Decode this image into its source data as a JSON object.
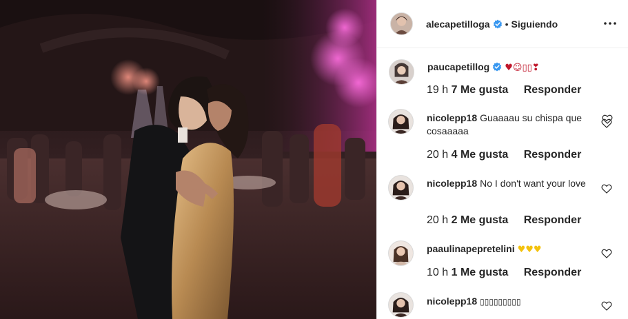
{
  "post": {
    "author": "alecapetilloga",
    "separator": "•",
    "follow_status": "Siguiendo"
  },
  "icons": {
    "verified": "verified-badge-icon",
    "more": "more-options-icon",
    "like": "heart-outline-icon"
  },
  "colors": {
    "verified_blue": "#3897f0",
    "meta_gray": "#8e8e8e",
    "text": "#262626",
    "heart_red": "#c0172b",
    "heart_yellow": "#f4c20d"
  },
  "comments": [
    {
      "username": "paucapetillog",
      "verified": true,
      "text": "",
      "emojis": "♥☺▯▯❣",
      "time": "19 h",
      "likes": "7 Me gusta",
      "reply": "Responder"
    },
    {
      "username": "nicolepp18",
      "verified": false,
      "text": "Guaaaau su chispa que cosaaaaa",
      "emojis": "",
      "time": "20 h",
      "likes": "4 Me gusta",
      "reply": "Responder"
    },
    {
      "username": "nicolepp18",
      "verified": false,
      "text": "No I don't want your love",
      "emojis": "",
      "time": "20 h",
      "likes": "2 Me gusta",
      "reply": "Responder"
    },
    {
      "username": "paaulinapepretelini",
      "verified": false,
      "text": "",
      "emojis": "♥♥♥",
      "time": "10 h",
      "likes": "1 Me gusta",
      "reply": "Responder"
    },
    {
      "username": "nicolepp18",
      "verified": false,
      "text": "",
      "emojis": "▯▯▯▯▯▯▯▯▯",
      "time": "",
      "likes": "",
      "reply": ""
    }
  ]
}
